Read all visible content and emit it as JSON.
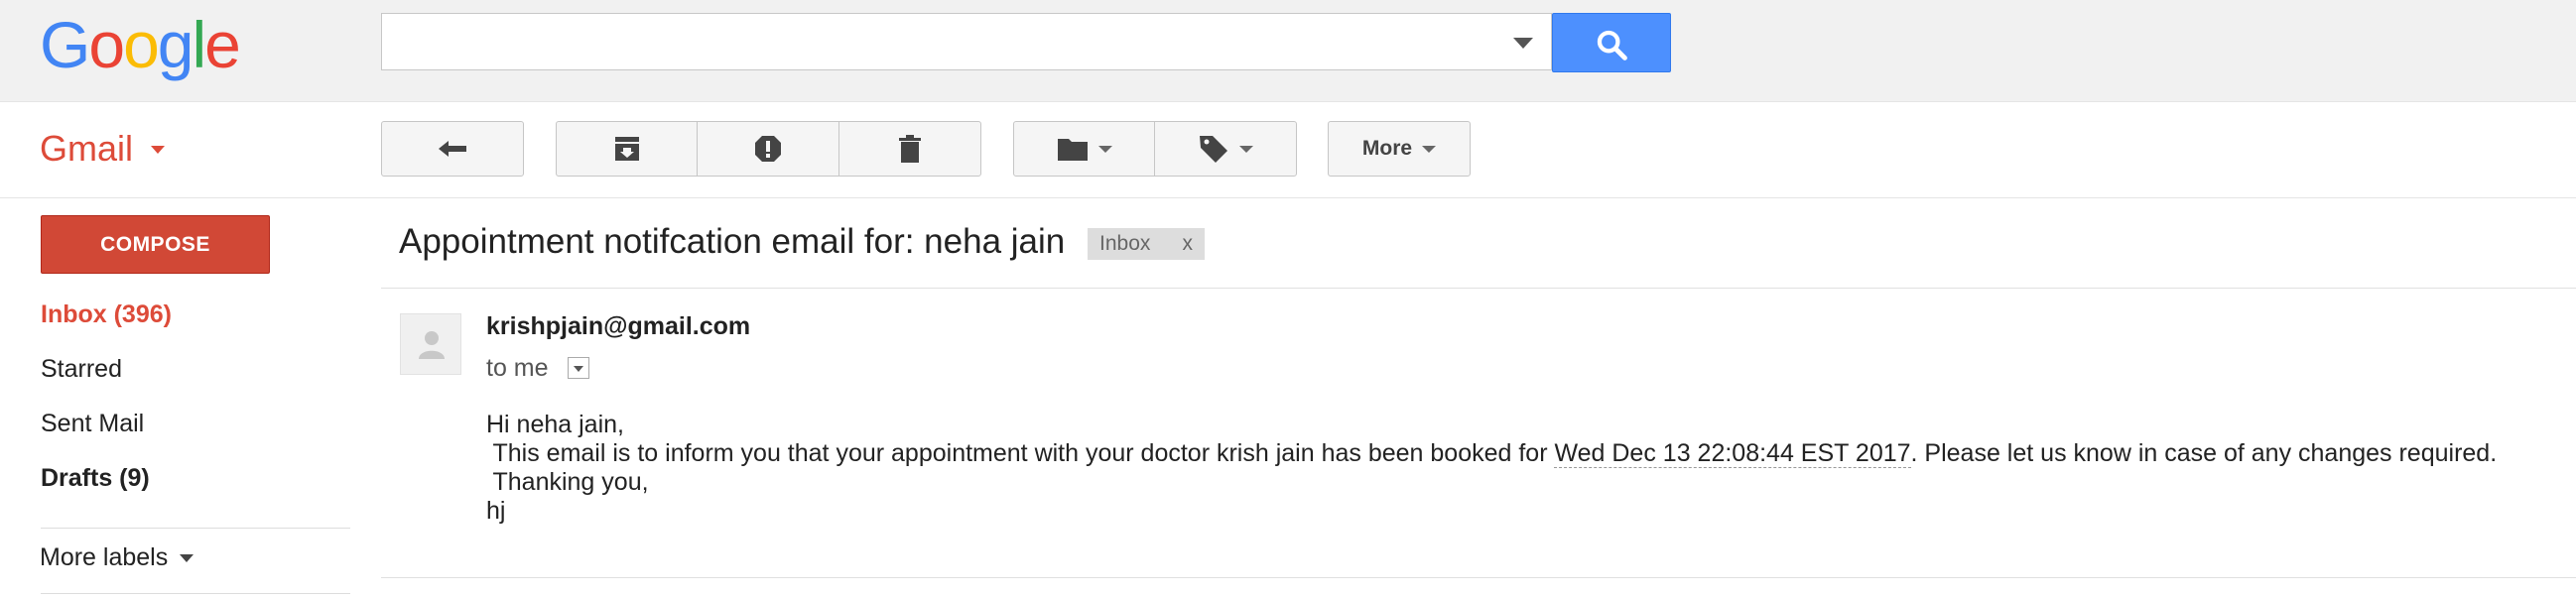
{
  "logo": {
    "letters": [
      "G",
      "o",
      "o",
      "g",
      "l",
      "e"
    ],
    "colors": [
      "#4285F4",
      "#EA4335",
      "#FBBC05",
      "#4285F4",
      "#34A853",
      "#EA4335"
    ]
  },
  "search": {
    "value": "",
    "placeholder": "",
    "button_icon": "search-icon",
    "button_color": "#4d90fe"
  },
  "app": {
    "name": "Gmail",
    "accent": "#dd4b39"
  },
  "toolbar": {
    "reply_icon": "reply-icon",
    "archive_icon": "archive-icon",
    "spam_icon": "report-spam-icon",
    "delete_icon": "trash-icon",
    "move_icon": "folder-icon",
    "labels_icon": "label-tag-icon",
    "more_label": "More"
  },
  "sidebar": {
    "compose_label": "COMPOSE",
    "compose_color": "#d14836",
    "items": [
      {
        "label": "Inbox (396)",
        "state": "active"
      },
      {
        "label": "Starred",
        "state": "normal"
      },
      {
        "label": "Sent Mail",
        "state": "normal"
      },
      {
        "label": "Drafts (9)",
        "state": "bold"
      }
    ],
    "more_labels": "More labels"
  },
  "message": {
    "subject": "Appointment notifcation email for: neha jain",
    "label_chip": "Inbox",
    "label_chip_remove": "x",
    "sender": "krishpjain@gmail.com",
    "to": "to me",
    "body": {
      "greeting": "Hi neha jain,",
      "line1_before": " This email is to inform you that your appointment with your doctor krish jain has been booked for ",
      "date": "Wed Dec 13 22:08:44 EST 2017",
      "line1_after": ". Please let us know in case of any changes required.",
      "line2": " Thanking you,",
      "signature": "hj"
    }
  }
}
